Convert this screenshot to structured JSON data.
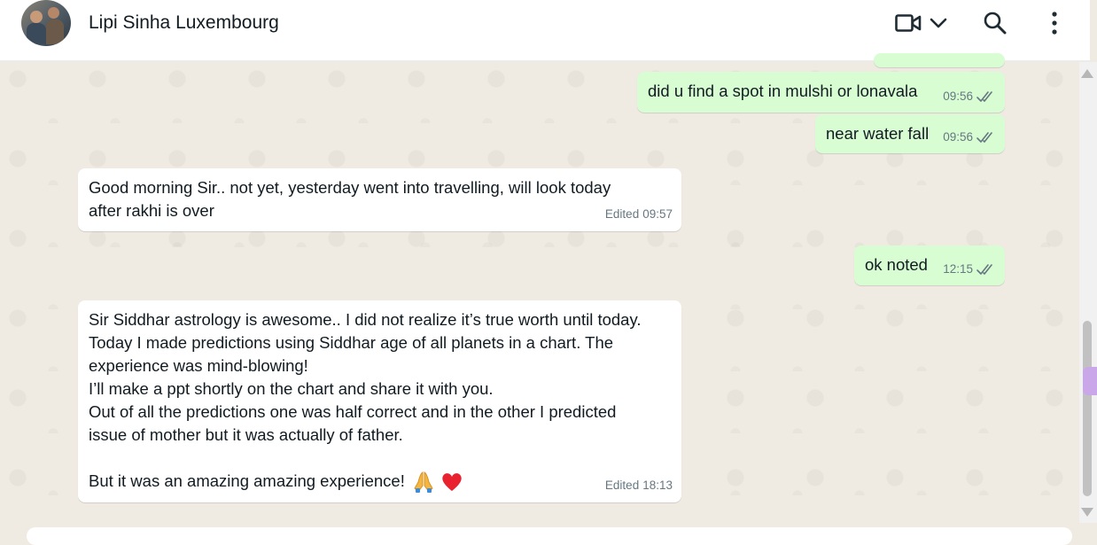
{
  "header": {
    "contact_name": "Lipi Sinha Luxembourg",
    "icons": [
      "video-call-icon",
      "chevron-down-icon",
      "search-icon",
      "menu-icon"
    ]
  },
  "messages": [
    {
      "direction": "outgoing",
      "lines": [
        "did u find a spot in mulshi or lonavala"
      ],
      "time": "09:56",
      "status": "read"
    },
    {
      "direction": "outgoing",
      "lines": [
        "near water fall"
      ],
      "time": "09:56",
      "status": "read"
    },
    {
      "direction": "incoming",
      "lines": [
        "Good morning Sir.. not yet, yesterday went into travelling, will look today",
        "after rakhi is over"
      ],
      "edited_label": "Edited",
      "time": "09:57"
    },
    {
      "direction": "outgoing",
      "lines": [
        "ok noted"
      ],
      "time": "12:15",
      "status": "read"
    },
    {
      "direction": "incoming",
      "lines": [
        "Sir Siddhar astrology is awesome.. I did not realize it’s true worth until today.",
        "Today I made predictions using Siddhar age of all planets in a chart. The",
        "experience was mind-blowing!",
        "I’ll make a ppt shortly on the chart and share it with you.",
        "Out of all the predictions one was half correct and in the other I predicted",
        "issue of mother but it was actually of father.",
        "",
        "But it was an amazing amazing experience!"
      ],
      "emojis": [
        "folded-hands",
        "red-heart"
      ],
      "edited_label": "Edited",
      "time": "18:13"
    }
  ],
  "colors": {
    "outgoing_bubble": "#d9fdd3",
    "incoming_bubble": "#ffffff",
    "chat_background": "#efeae2",
    "read_tick": "#53bdeb",
    "meta_text": "#667781"
  }
}
